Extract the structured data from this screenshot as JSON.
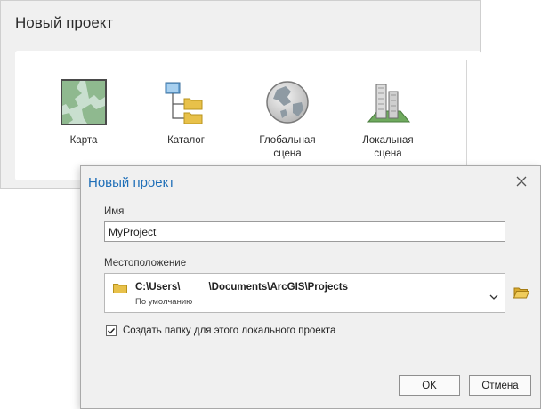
{
  "background_window": {
    "title": "Новый проект",
    "templates": [
      {
        "label": "Карта",
        "icon": "map-icon"
      },
      {
        "label": "Каталог",
        "icon": "catalog-icon"
      },
      {
        "label": "Глобальная\nсцена",
        "icon": "globe-icon"
      },
      {
        "label": "Локальная\nсцена",
        "icon": "local-scene-icon"
      }
    ]
  },
  "dialog": {
    "title": "Новый проект",
    "name_label": "Имя",
    "name_value": "MyProject",
    "location_label": "Местоположение",
    "location_path": "C:\\Users\\          \\Documents\\ArcGIS\\Projects",
    "location_sub": "По умолчанию",
    "checkbox_label": "Создать папку для этого локального проекта",
    "checkbox_checked": true,
    "ok_label": "OK",
    "cancel_label": "Отмена"
  },
  "colors": {
    "title_blue": "#1f6fb8",
    "folder_yellow": "#e8c14a"
  }
}
